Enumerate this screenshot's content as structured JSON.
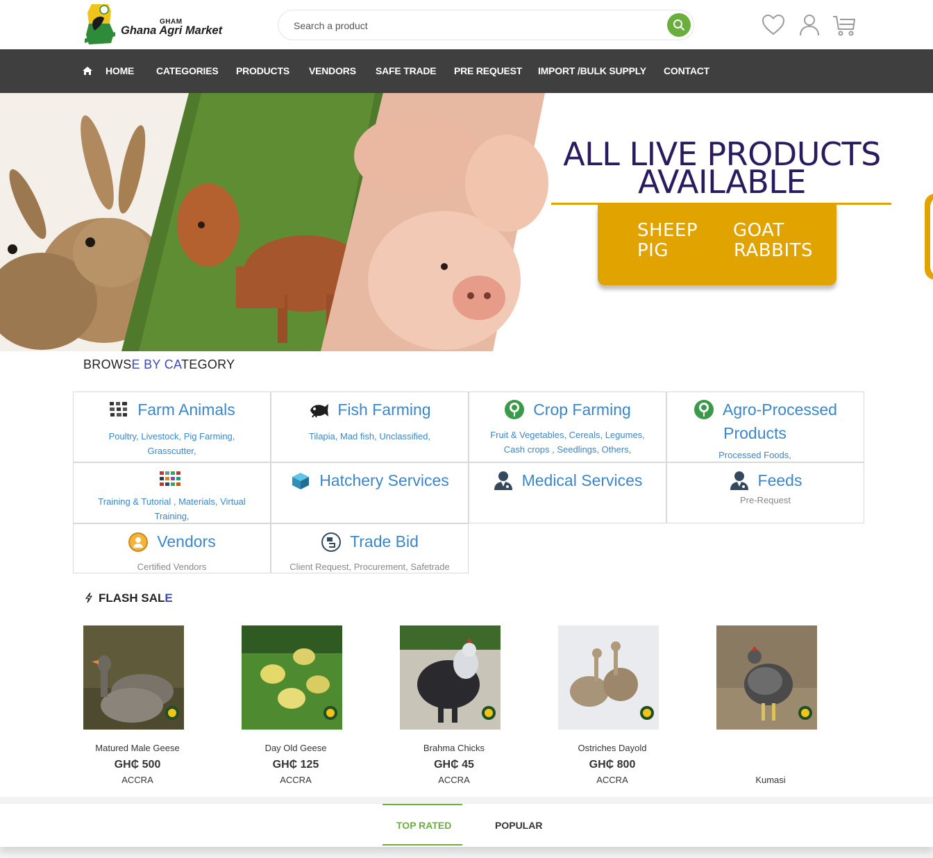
{
  "header": {
    "logo_small": "GHAM",
    "logo_name": "Ghana Agri Market",
    "search_placeholder": "Search a product"
  },
  "icons": {
    "search": "search-icon",
    "wishlist": "heart-icon",
    "account": "user-icon",
    "cart": "cart-icon",
    "home": "home-icon",
    "flash": "lightning-icon"
  },
  "nav": {
    "items": [
      "HOME",
      "CATEGORIES",
      "PRODUCTS",
      "VENDORS",
      "SAFE TRADE",
      "PRE REQUEST",
      "IMPORT /BULK SUPPLY",
      "CONTACT"
    ]
  },
  "banner": {
    "title_line1": "ALL LIVE PRODUCTS",
    "title_line2": "AVAILABLE",
    "animals": [
      "SHEEP",
      "GOAT",
      "PIG",
      "RABBITS"
    ]
  },
  "browse": {
    "title_part1": "BROWS",
    "title_part2": "E BY CA",
    "title_part3": "TEGORY",
    "categories": [
      {
        "name": "Farm Animals",
        "sub_line1": "Poultry,  Livestock,  Pig Farming,",
        "sub_line2": "Grasscutter,"
      },
      {
        "name": "Fish Farming",
        "sub_line1": "Tilapia,  Mad fish,  Unclassified,",
        "sub_line2": ""
      },
      {
        "name": "Crop Farming",
        "sub_line1": "Fruit & Vegetables,  Cereals,  Legumes,",
        "sub_line2": "Cash crops ,  Seedlings,  Others,"
      },
      {
        "name": "Agro-Processed",
        "name_line2": "Products",
        "sub_line1": "Processed Foods,",
        "sub_line2": ""
      },
      {
        "name": "",
        "sub_line1": "Training & Tutorial ,  Materials,  Virtual",
        "sub_line2": "Training,"
      },
      {
        "name": "Hatchery Services",
        "sub_line1": "",
        "sub_line2": ""
      },
      {
        "name": "Medical Services",
        "sub_line1": "",
        "sub_line2": ""
      },
      {
        "name": "Feeds",
        "sub_line1": "Pre-Request",
        "sub_line2": ""
      },
      {
        "name": "Vendors",
        "sub_line1": "Certified Vendors",
        "sub_line2": ""
      },
      {
        "name": "Trade Bid",
        "sub_line1": "Client Request, Procurement, Safetrade",
        "sub_line2": ""
      }
    ]
  },
  "flash_sale": {
    "title_part1": "FLASH SAL",
    "title_part2": "E",
    "products": [
      {
        "name": "Matured Male Geese",
        "price": "GH₵ 500",
        "location": "ACCRA"
      },
      {
        "name": "Day Old Geese",
        "price": "GH₵ 125",
        "location": "ACCRA"
      },
      {
        "name": "Brahma Chicks",
        "price": "GH₵ 45",
        "location": "ACCRA"
      },
      {
        "name": "Ostriches Dayold",
        "price": "GH₵ 800",
        "location": "ACCRA"
      },
      {
        "name": "",
        "price": "",
        "location": "Kumasi"
      }
    ]
  },
  "tabs": [
    "TOP RATED",
    "POPULAR"
  ],
  "colors": {
    "nav_bg": "#3f3f3f",
    "accent_green": "#6aaf3d",
    "category_blue": "#3b86c8",
    "banner_gold": "#e1a300",
    "banner_title": "#2a1a5e"
  }
}
